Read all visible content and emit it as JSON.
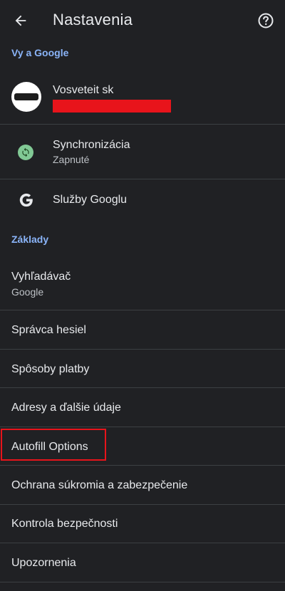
{
  "header": {
    "title": "Nastavenia",
    "back_icon": "arrow-back-icon",
    "help_icon": "help-circle-icon"
  },
  "section_you_google": {
    "label": "Vy a Google",
    "account": {
      "name": "Vosveteit sk"
    },
    "sync": {
      "title": "Synchronizácia",
      "subtitle": "Zapnuté"
    },
    "google_services": {
      "title": "Služby Googlu"
    }
  },
  "section_basics": {
    "label": "Základy",
    "items": [
      {
        "title": "Vyhľadávač",
        "subtitle": "Google"
      },
      {
        "title": "Správca hesiel"
      },
      {
        "title": "Spôsoby platby"
      },
      {
        "title": "Adresy a ďalšie údaje"
      },
      {
        "title": "Autofill Options"
      },
      {
        "title": "Ochrana súkromia a zabezpečenie"
      },
      {
        "title": "Kontrola bezpečnosti"
      },
      {
        "title": "Upozornenia"
      }
    ]
  },
  "colors": {
    "background": "#202124",
    "accent": "#8ab4f8",
    "divider": "#3c4043",
    "sync_green": "#81c995",
    "highlight_red": "#e8141b"
  }
}
